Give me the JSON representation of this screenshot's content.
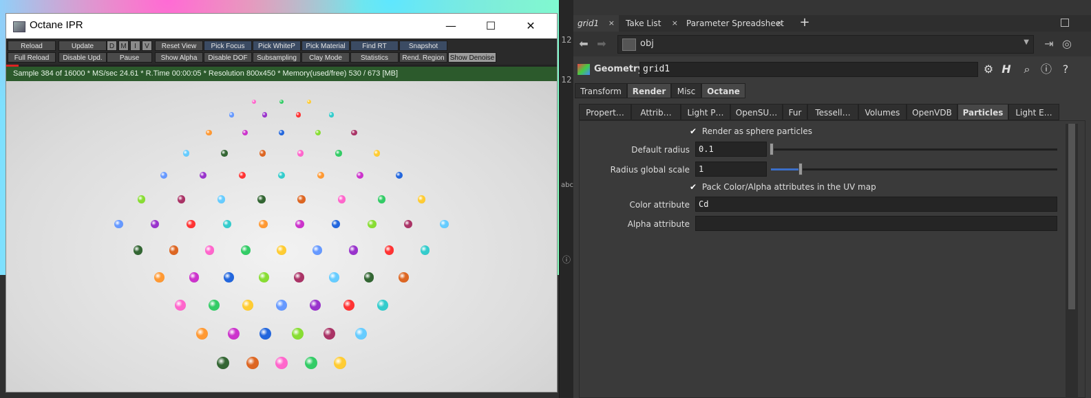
{
  "ipr_window": {
    "title": "Octane IPR",
    "minimize_glyph": "—",
    "maximize_glyph": "☐",
    "close_glyph": "✕",
    "toolbar_row1": [
      "Reload",
      "Update",
      "D",
      "M",
      "I",
      "V",
      "Reset View",
      "Pick Focus",
      "Pick WhiteP",
      "Pick Material",
      "Find RT",
      "Snapshot"
    ],
    "toolbar_row2": [
      "Full Reload",
      "Disable Upd.",
      "Pause",
      "Show Alpha",
      "Disable DOF",
      "Subsampling",
      "Clay Mode",
      "Statistics",
      "Rend. Region",
      "Show Denoise"
    ],
    "status": "Sample 384 of 16000 * MS/sec 24.61 * R.Time 00:00:05 * Resolution 800x450 * Memory(used/free) 530 / 673 [MB]"
  },
  "render_spheres": {
    "description_colors": [
      "#ff66cc",
      "#33cc66",
      "#ffcc33",
      "#6699ff",
      "#9933cc",
      "#ff3333",
      "#33cccc",
      "#ff9933",
      "#cc33cc",
      "#2266dd",
      "#88dd33",
      "#aa3366",
      "#66ccff",
      "#336633",
      "#dd6622"
    ]
  },
  "side_strip": {
    "labels": [
      "12",
      "12",
      "abc"
    ]
  },
  "panel": {
    "tabs": [
      {
        "label": "grid1",
        "close": "×"
      },
      {
        "label": "Take List",
        "close": "×"
      },
      {
        "label": "Parameter Spreadsheet",
        "close": "×"
      }
    ],
    "add_tab_glyph": "+",
    "path": "obj",
    "node_type_label": "Geometry",
    "node_name": "grid1",
    "tabs_level1": [
      "Transform",
      "Render",
      "Misc",
      "Octane"
    ],
    "tabs_level2": [
      "Propert…",
      "Attrib…",
      "Light P…",
      "OpenSU…",
      "Fur",
      "Tessell…",
      "Volumes",
      "OpenVDB",
      "Particles",
      "Light E…"
    ],
    "params": {
      "render_as_sphere": "Render as sphere particles",
      "default_radius_label": "Default radius",
      "default_radius_value": "0.1",
      "default_radius_slider": 0.0,
      "radius_scale_label": "Radius global scale",
      "radius_scale_value": "1",
      "radius_scale_slider": 0.1,
      "pack_color_alpha": "Pack Color/Alpha attributes in the UV map",
      "color_attr_label": "Color attribute",
      "color_attr_value": "Cd",
      "alpha_attr_label": "Alpha attribute",
      "alpha_attr_value": ""
    }
  }
}
